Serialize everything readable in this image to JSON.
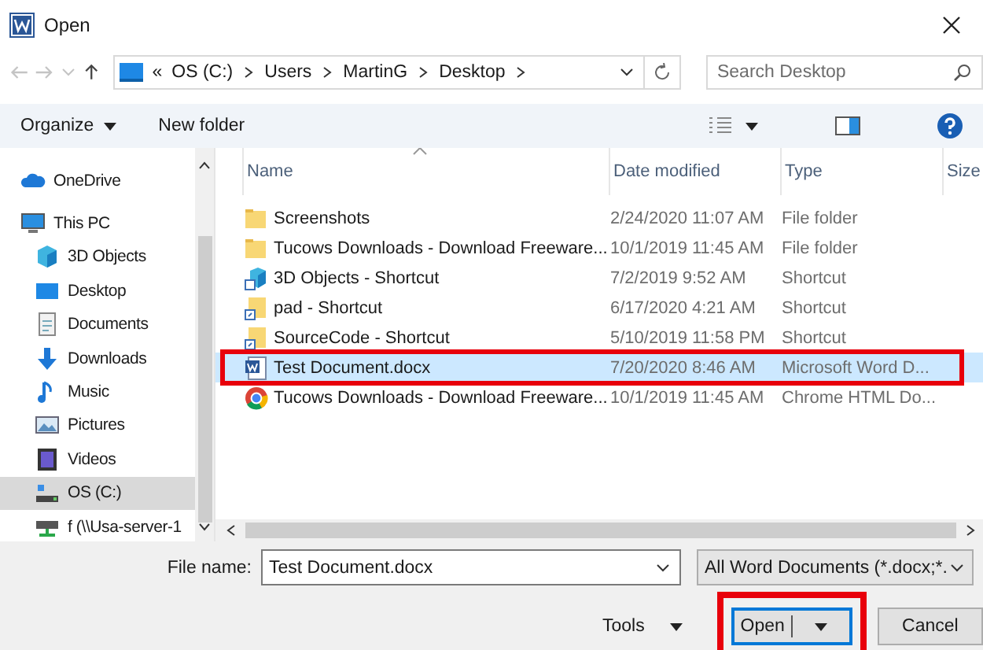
{
  "window": {
    "title": "Open"
  },
  "address": {
    "overflow": "«",
    "segments": [
      "OS (C:)",
      "Users",
      "MartinG",
      "Desktop"
    ]
  },
  "search": {
    "placeholder": "Search Desktop"
  },
  "toolbar": {
    "organize": "Organize",
    "new_folder": "New folder"
  },
  "sidebar": {
    "items": [
      {
        "label": "OneDrive",
        "kind": "cloud",
        "selected": false
      },
      {
        "label": "This PC",
        "kind": "pc",
        "selected": false,
        "children": [
          {
            "label": "3D Objects",
            "kind": "cube",
            "selected": false
          },
          {
            "label": "Desktop",
            "kind": "desktop",
            "selected": false
          },
          {
            "label": "Documents",
            "kind": "documents",
            "selected": false
          },
          {
            "label": "Downloads",
            "kind": "downloads",
            "selected": false
          },
          {
            "label": "Music",
            "kind": "music",
            "selected": false
          },
          {
            "label": "Pictures",
            "kind": "pictures",
            "selected": false
          },
          {
            "label": "Videos",
            "kind": "videos",
            "selected": false
          },
          {
            "label": "OS (C:)",
            "kind": "drive",
            "selected": true
          },
          {
            "label": "f (\\\\Usa-server-1",
            "kind": "network-drive",
            "selected": false
          }
        ]
      }
    ]
  },
  "columns": [
    "Name",
    "Date modified",
    "Type",
    "Size"
  ],
  "files": [
    {
      "name": "Screenshots",
      "date": "2/24/2020 11:07 AM",
      "type": "File folder",
      "kind": "folder",
      "selected": false,
      "highlighted": false
    },
    {
      "name": "Tucows Downloads - Download Freeware...",
      "date": "10/1/2019 11:45 AM",
      "type": "File folder",
      "kind": "folder",
      "selected": false,
      "highlighted": false
    },
    {
      "name": "3D Objects - Shortcut",
      "date": "7/2/2019 9:52 AM",
      "type": "Shortcut",
      "kind": "cube-shortcut",
      "selected": false,
      "highlighted": false
    },
    {
      "name": "pad - Shortcut",
      "date": "6/17/2020 4:21 AM",
      "type": "Shortcut",
      "kind": "folder-shortcut",
      "selected": false,
      "highlighted": false
    },
    {
      "name": "SourceCode - Shortcut",
      "date": "5/10/2019 11:58 PM",
      "type": "Shortcut",
      "kind": "folder-shortcut",
      "selected": false,
      "highlighted": false
    },
    {
      "name": "Test Document.docx",
      "date": "7/20/2020 8:46 AM",
      "type": "Microsoft Word D...",
      "kind": "word",
      "selected": true,
      "highlighted": true
    },
    {
      "name": "Tucows Downloads - Download Freeware...",
      "date": "10/1/2019 11:45 AM",
      "type": "Chrome HTML Do...",
      "kind": "chrome",
      "selected": false,
      "highlighted": false
    }
  ],
  "footer": {
    "file_name_label": "File name:",
    "file_name": "Test Document.docx",
    "file_type": "All Word Documents (*.docx;*.",
    "tools": "Tools",
    "open": {
      "label": "Open",
      "highlighted": true
    },
    "cancel": "Cancel"
  }
}
